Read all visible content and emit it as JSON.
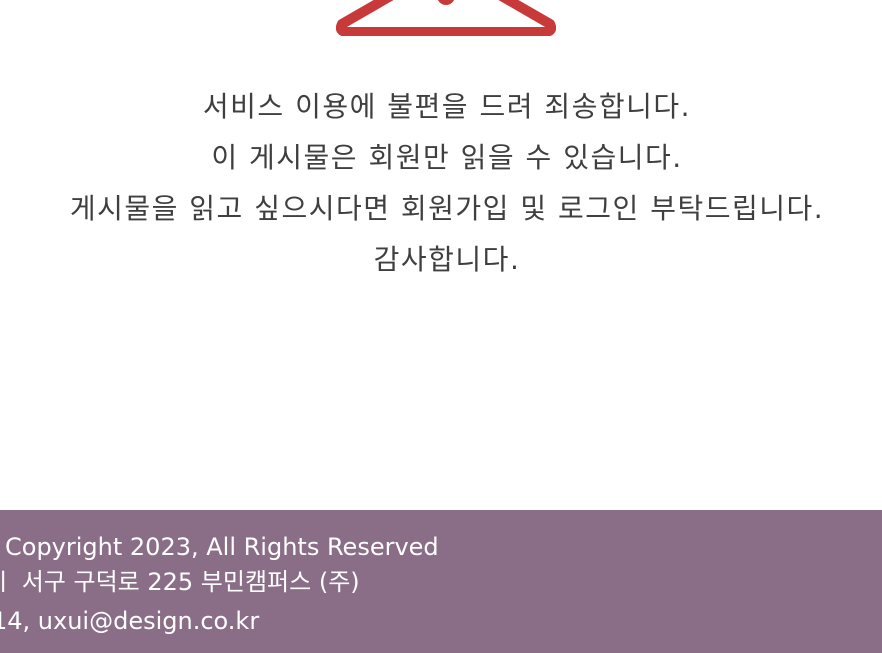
{
  "colors": {
    "accent": "#c8393a",
    "footer_bg": "#8a6d87",
    "message_text": "#3f3f3f",
    "footer_text": "#ffffff"
  },
  "warning": {
    "icon": "warning-triangle-icon"
  },
  "message": {
    "lines": [
      "서비스 이용에 불편을 드려 죄송합니다.",
      "이 게시물은 회원만 읽을 수 있습니다.",
      "게시물을 읽고 싶으시다면 회원가입 및 로그인 부탁드립니다.",
      "감사합니다."
    ]
  },
  "footer": {
    "copyright": "Copyright 2023, All Rights Reserved",
    "address": "ㅣ 서구 구덕로 225 부민캠퍼스 (주)",
    "contact": "14, uxui@design.co.kr"
  }
}
